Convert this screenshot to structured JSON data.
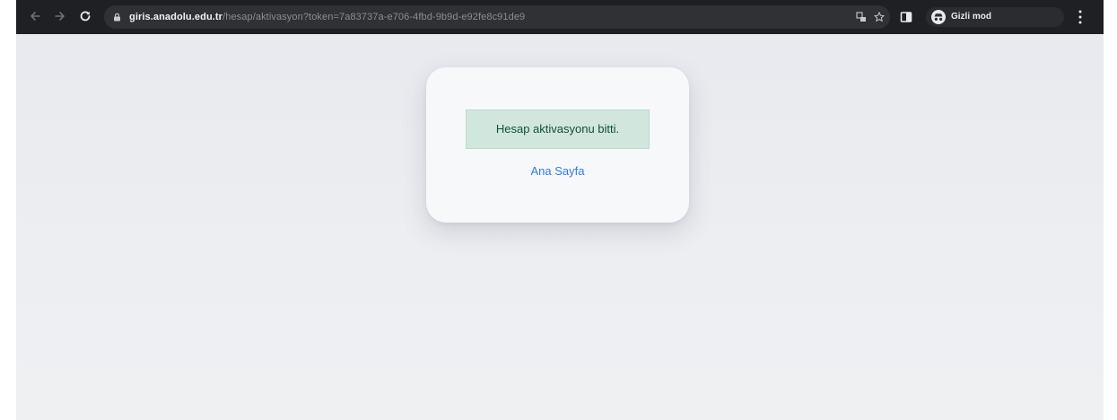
{
  "browser": {
    "url_host": "giris.anadolu.edu.tr",
    "url_path": "/hesap/aktivasyon?token=7a83737a-e706-4fbd-9b9d-e92fe8c91de9",
    "incognito_label": "Gizli mod",
    "icons": {
      "back": "arrow-left-icon",
      "forward": "arrow-right-icon",
      "reload": "reload-icon",
      "lock": "lock-icon",
      "translate": "translate-icon",
      "bookmark": "star-icon",
      "side_panel": "side-panel-icon",
      "incognito": "incognito-icon",
      "menu": "more-vert-icon"
    }
  },
  "page": {
    "alert_text": "Hesap aktivasyonu bitti.",
    "home_link": "Ana Sayfa"
  },
  "colors": {
    "alert_bg": "#d1e7dd",
    "alert_text": "#0f5132",
    "link": "#2f7be6",
    "toolbar": "#1f2023"
  }
}
